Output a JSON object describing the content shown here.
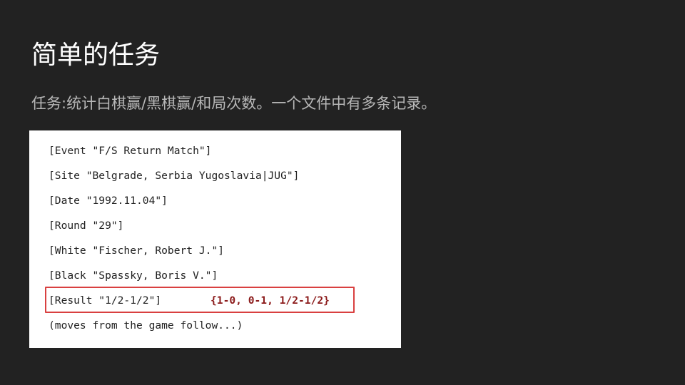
{
  "slide": {
    "title": "简单的任务",
    "subtitle": "任务:统计白棋赢/黑棋赢/和局次数。一个文件中有多条记录。",
    "background_color": "#222222",
    "accent_color": "#d94040"
  },
  "pgn_sample": {
    "lines": [
      "[Event \"F/S Return Match\"]",
      "[Site \"Belgrade, Serbia Yugoslavia|JUG\"]",
      "[Date \"1992.11.04\"]",
      "[Round \"29\"]",
      "[White \"Fischer, Robert J.\"]",
      "[Black \"Spassky, Boris V.\"]",
      "[Result \"1/2-1/2\"]",
      "(moves from the game follow...)"
    ],
    "result_options": "{1-0, 0-1, 1/2-1/2}"
  }
}
